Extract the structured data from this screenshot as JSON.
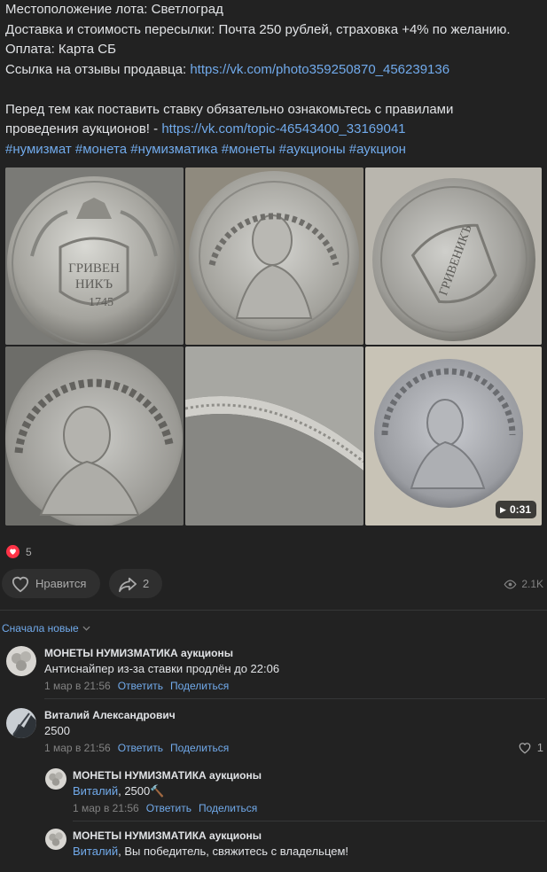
{
  "post": {
    "line1": "Местоположение лота: Светлоград",
    "line2": "Доставка и стоимость пересылки: Почта 250 рублей, страховка +4% по желанию.",
    "line3": "Оплата: Карта СБ",
    "line4_prefix": "Ссылка на отзывы продавца: ",
    "line4_link": "https://vk.com/photo359250870_456239136",
    "line5": "Перед тем как поставить ставку обязательно ознакомьтесь с правилами",
    "line6_prefix": "проведения аукционов! - ",
    "line6_link": "https://vk.com/topic-46543400_33169041",
    "hashtags": "#нумизмат #монета #нумизматика #монеты #аукционы #аукцион"
  },
  "video_duration": "0:31",
  "reactions": {
    "count": "5",
    "like_label": "Нравится",
    "shares": "2",
    "views": "2.1K"
  },
  "comments_sort": "Сначала новые",
  "comments": [
    {
      "author": "МОНЕТЫ НУМИЗМАТИКА аукционы",
      "text": "Антиснайпер из-за ставки продлён до 22:06",
      "date": "1 мар в 21:56",
      "reply": "Ответить",
      "share": "Поделиться"
    },
    {
      "author": "Виталий Александрович",
      "text": "2500",
      "date": "1 мар в 21:56",
      "reply": "Ответить",
      "share": "Поделиться",
      "likes": "1"
    },
    {
      "author": "МОНЕТЫ НУМИЗМАТИКА аукционы",
      "mention": "Виталий",
      "text": ", 2500🔨",
      "date": "1 мар в 21:56",
      "reply": "Ответить",
      "share": "Поделиться"
    },
    {
      "author": "МОНЕТЫ НУМИЗМАТИКА аукционы",
      "mention": "Виталий",
      "text": ", Вы победитель, свяжитесь с владельцем!"
    }
  ],
  "colors": {
    "background": "#222222",
    "link": "#71aaeb",
    "like_badge": "#ff3347",
    "text": "#e1e3e6",
    "muted": "#828282"
  }
}
